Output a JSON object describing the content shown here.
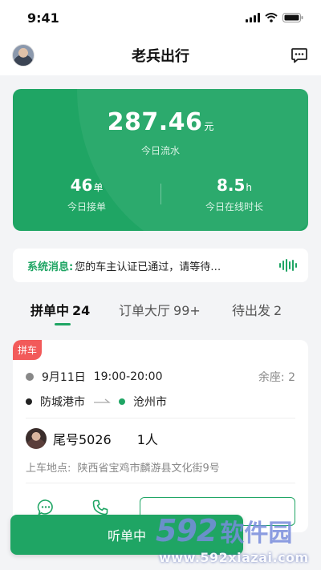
{
  "status_bar": {
    "time": "9:41"
  },
  "nav": {
    "title": "老兵出行"
  },
  "stats": {
    "income_value": "287.46",
    "income_unit": "元",
    "income_label": "今日流水",
    "orders_value": "46",
    "orders_unit": "单",
    "orders_label": "今日接单",
    "online_value": "8.5",
    "online_unit": "h",
    "online_label": "今日在线时长"
  },
  "notice": {
    "label": "系统消息:",
    "text": "您的车主认证已通过，请等待…"
  },
  "tabs": [
    {
      "label": "拼单中",
      "count": "24",
      "active": true
    },
    {
      "label": "订单大厅",
      "count": "99+",
      "active": false
    },
    {
      "label": "待出发",
      "count": "2",
      "active": false
    }
  ],
  "order": {
    "badge": "拼车",
    "date": "9月11日",
    "time_range": "19:00-20:00",
    "seats": "余座: 2",
    "from": "防城港市",
    "to": "沧州市",
    "passenger_tail": "尾号5026",
    "passenger_count": "1人",
    "pickup_label": "上车地点:",
    "pickup_address": "陕西省宝鸡市麟游县文化街9号"
  },
  "bottom": {
    "listen_label": "听单中"
  },
  "watermark": {
    "logo_num": "592",
    "logo_text": "软件园",
    "url": "www.592xiazai.com"
  },
  "colors": {
    "accent": "#1fa564",
    "badge": "#f25a5a"
  }
}
